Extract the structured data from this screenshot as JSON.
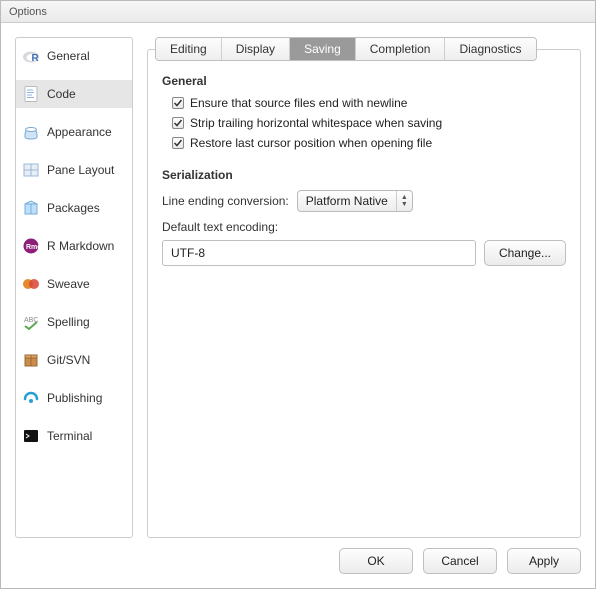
{
  "window": {
    "title": "Options"
  },
  "sidebar": {
    "items": [
      {
        "label": "General"
      },
      {
        "label": "Code"
      },
      {
        "label": "Appearance"
      },
      {
        "label": "Pane Layout"
      },
      {
        "label": "Packages"
      },
      {
        "label": "R Markdown"
      },
      {
        "label": "Sweave"
      },
      {
        "label": "Spelling"
      },
      {
        "label": "Git/SVN"
      },
      {
        "label": "Publishing"
      },
      {
        "label": "Terminal"
      }
    ],
    "active_index": 1
  },
  "tabs": {
    "items": [
      {
        "label": "Editing"
      },
      {
        "label": "Display"
      },
      {
        "label": "Saving"
      },
      {
        "label": "Completion"
      },
      {
        "label": "Diagnostics"
      }
    ],
    "active_index": 2
  },
  "sections": {
    "general": {
      "title": "General",
      "checks": [
        {
          "label": "Ensure that source files end with newline",
          "checked": true
        },
        {
          "label": "Strip trailing horizontal whitespace when saving",
          "checked": true
        },
        {
          "label": "Restore last cursor position when opening file",
          "checked": true
        }
      ]
    },
    "serialization": {
      "title": "Serialization",
      "line_ending_label": "Line ending conversion:",
      "line_ending_value": "Platform Native",
      "encoding_label": "Default text encoding:",
      "encoding_value": "UTF-8",
      "change_button": "Change..."
    }
  },
  "footer": {
    "ok": "OK",
    "cancel": "Cancel",
    "apply": "Apply"
  }
}
